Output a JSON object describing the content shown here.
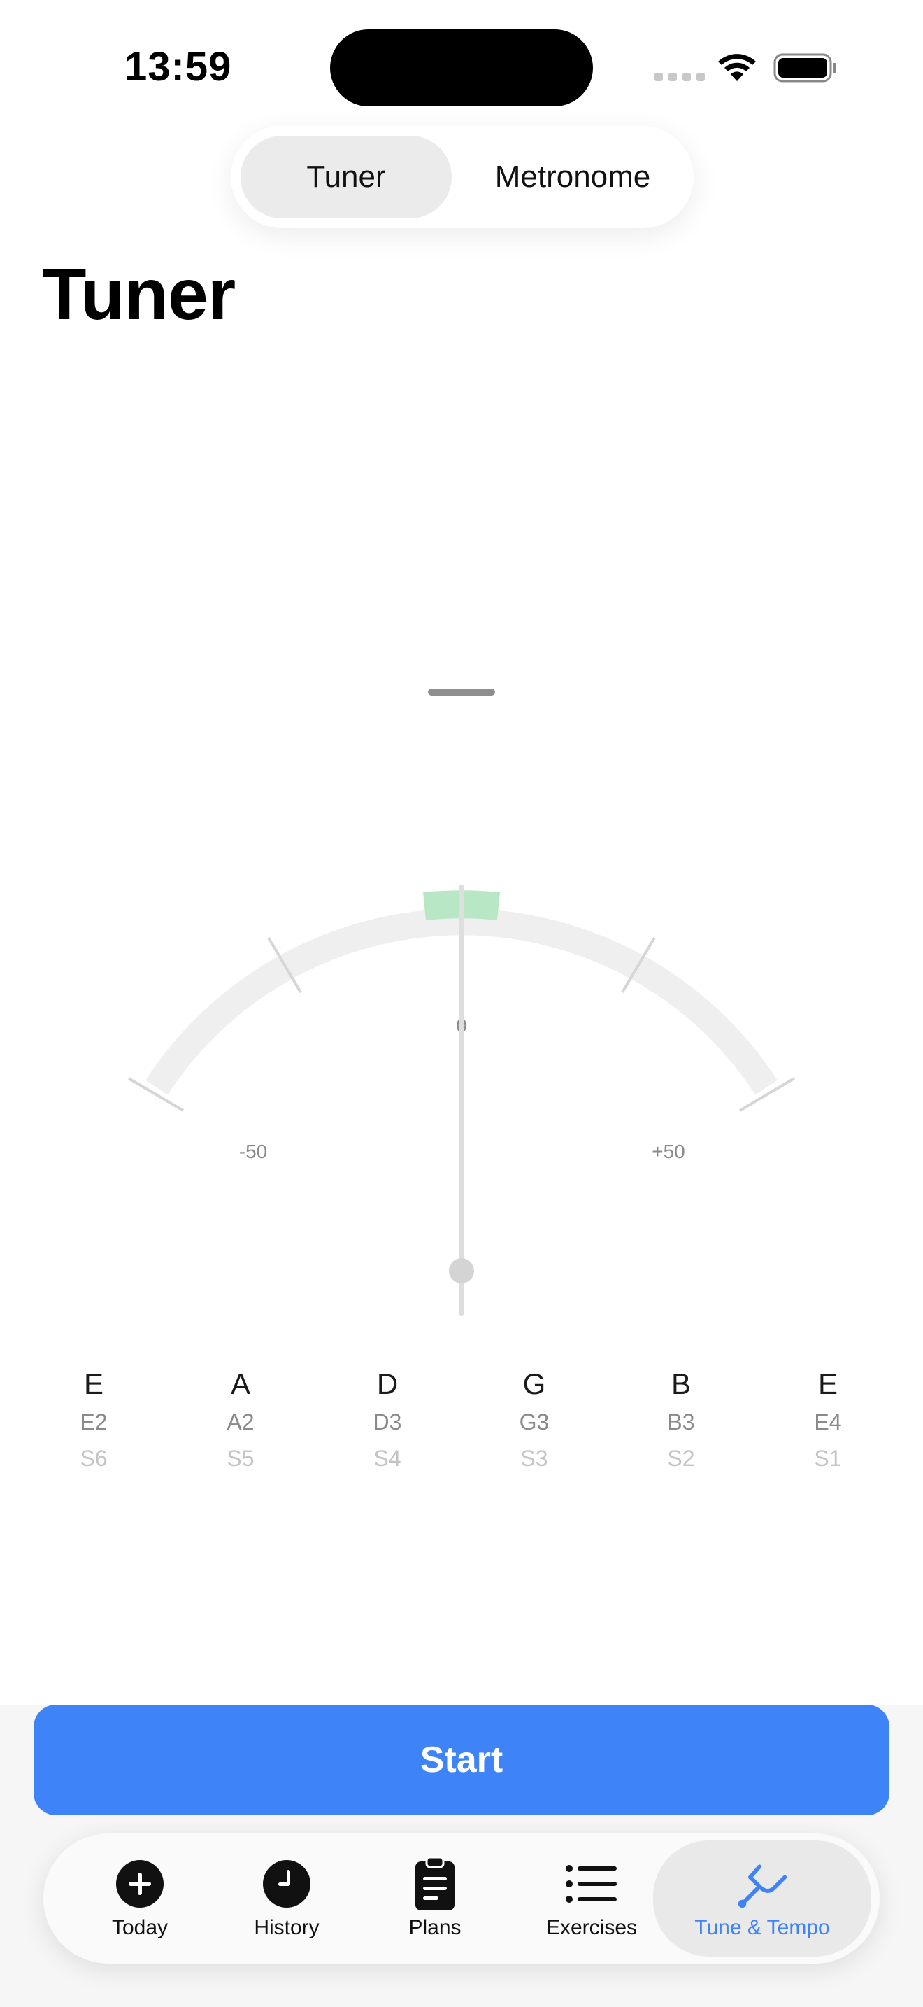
{
  "status_bar": {
    "time": "13:59"
  },
  "segmented_control": {
    "options": [
      {
        "label": "Tuner",
        "selected": true
      },
      {
        "label": "Metronome",
        "selected": false
      }
    ]
  },
  "page": {
    "title": "Tuner"
  },
  "gauge": {
    "center_label": "0",
    "left_label": "-50",
    "right_label": "+50",
    "in_tune_color": "#b7e7c4",
    "arc_color": "#efefef",
    "needle_cents": 0
  },
  "strings": [
    {
      "note": "E",
      "pitch": "E2",
      "string": "S6"
    },
    {
      "note": "A",
      "pitch": "A2",
      "string": "S5"
    },
    {
      "note": "D",
      "pitch": "D3",
      "string": "S4"
    },
    {
      "note": "G",
      "pitch": "G3",
      "string": "S3"
    },
    {
      "note": "B",
      "pitch": "B3",
      "string": "S2"
    },
    {
      "note": "E",
      "pitch": "E4",
      "string": "S1"
    }
  ],
  "start_button": {
    "label": "Start",
    "color": "#3f83f8"
  },
  "tab_bar": {
    "items": [
      {
        "label": "Today",
        "icon": "plus-circle-icon",
        "selected": false
      },
      {
        "label": "History",
        "icon": "clock-icon",
        "selected": false
      },
      {
        "label": "Plans",
        "icon": "clipboard-icon",
        "selected": false
      },
      {
        "label": "Exercises",
        "icon": "list-icon",
        "selected": false
      },
      {
        "label": "Tune & Tempo",
        "icon": "tuning-fork-icon",
        "selected": true
      }
    ],
    "accent_color": "#3f83f8"
  }
}
